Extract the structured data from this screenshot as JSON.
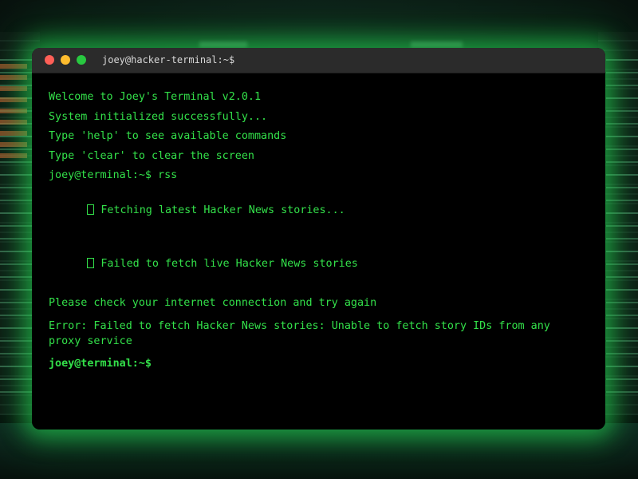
{
  "window": {
    "title": "joey@hacker-terminal:~$"
  },
  "terminal": {
    "lines": [
      "Welcome to Joey's Terminal v2.0.1",
      "System initialized successfully...",
      "Type 'help' to see available commands",
      "Type 'clear' to clear the screen",
      "joey@terminal:~$ rss"
    ],
    "fetching": "Fetching latest Hacker News stories...",
    "failed": "Failed to fetch live Hacker News stories",
    "check": "Please check your internet connection and try again",
    "error": "Error: Failed to fetch Hacker News stories: Unable to fetch story IDs from any proxy service",
    "prompt": "joey@terminal:~$"
  },
  "colors": {
    "text": "#33e14a",
    "background": "#000000",
    "glow": "#28e65a",
    "close": "#ff5f57",
    "minimize": "#febc2e",
    "maximize": "#28c840"
  }
}
